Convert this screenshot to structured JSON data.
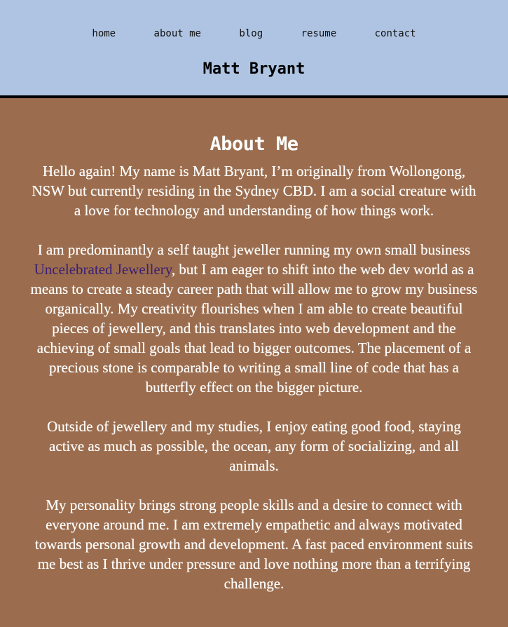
{
  "nav": {
    "items": [
      {
        "label": "home"
      },
      {
        "label": "about me"
      },
      {
        "label": "blog"
      },
      {
        "label": "resume"
      },
      {
        "label": "contact"
      }
    ]
  },
  "header": {
    "site_title": "Matt Bryant"
  },
  "main": {
    "heading": "About Me",
    "paragraph1": "Hello again! My name is Matt Bryant, I’m originally from Wollongong, NSW but currently residing in the Sydney CBD. I am a social creature with a love for technology and understanding of how things work.",
    "paragraph2_before": "I am predominantly a self taught jeweller running my own small business ",
    "paragraph2_link": "Uncelebrated Jewellery",
    "paragraph2_after": ", but I am eager to shift into the web dev world as a means to create a steady career path that will allow me to grow my business organically. My creativity flourishes when I am able to create beautiful pieces of jewellery, and this translates into web development and the achieving of small goals that lead to bigger outcomes. The placement of a precious stone is comparable to writing a small line of code that has a butterfly effect on the bigger picture.",
    "paragraph3": "Outside of jewellery and my studies, I enjoy eating good food, staying active as much as possible, the ocean, any form of socializing, and all animals.",
    "paragraph4": "My personality brings strong people skills and a desire to connect with everyone around me. I am extremely empathetic and always motivated towards personal growth and development. A fast paced environment suits me best as I thrive under pressure and love nothing more than a terrifying challenge."
  },
  "colors": {
    "header_bg": "#aec4e2",
    "body_bg": "#9b6d4e",
    "link": "#3a1f73",
    "text": "#ffffff"
  }
}
